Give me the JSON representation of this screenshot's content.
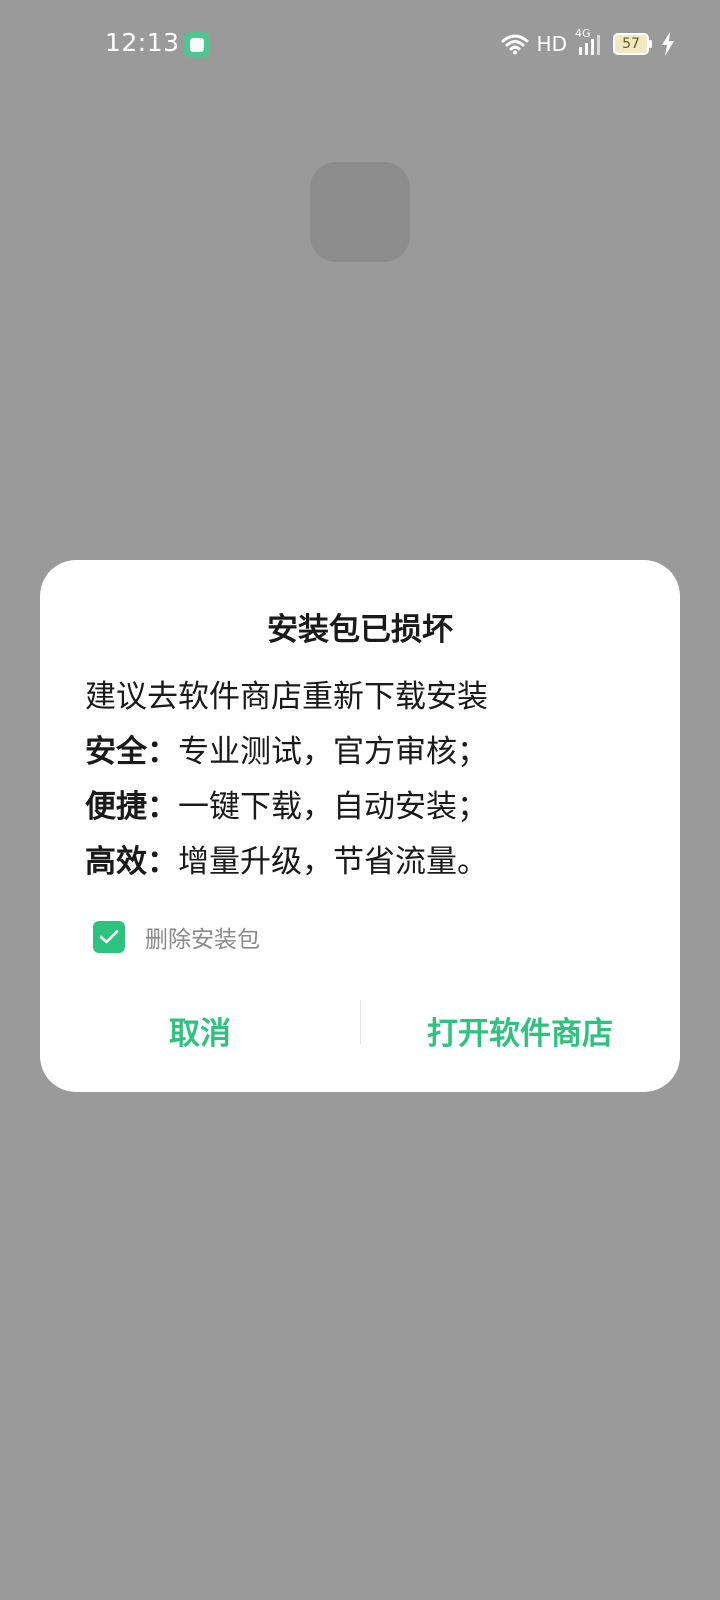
{
  "status_bar": {
    "time": "12:13",
    "network_label": "HD",
    "network_type": "4G",
    "battery_level": "57",
    "icons": [
      "app-notification-icon",
      "wifi-icon",
      "signal-icon",
      "battery-icon",
      "charging-icon"
    ]
  },
  "dialog": {
    "title": "安装包已损坏",
    "message_lines": [
      {
        "bold": "",
        "text": "建议去软件商店重新下载安装"
      },
      {
        "bold": "安全：",
        "text": "专业测试，官方审核；"
      },
      {
        "bold": "便捷：",
        "text": "一键下载，自动安装；"
      },
      {
        "bold": "高效：",
        "text": "增量升级，节省流量。"
      }
    ],
    "checkbox": {
      "label": "删除安装包",
      "checked": true
    },
    "buttons": {
      "cancel": "取消",
      "open_store": "打开软件商店"
    }
  },
  "colors": {
    "accent": "#2dc37f",
    "scrim": "#9a9a9a",
    "dialog_bg": "#ffffff"
  }
}
